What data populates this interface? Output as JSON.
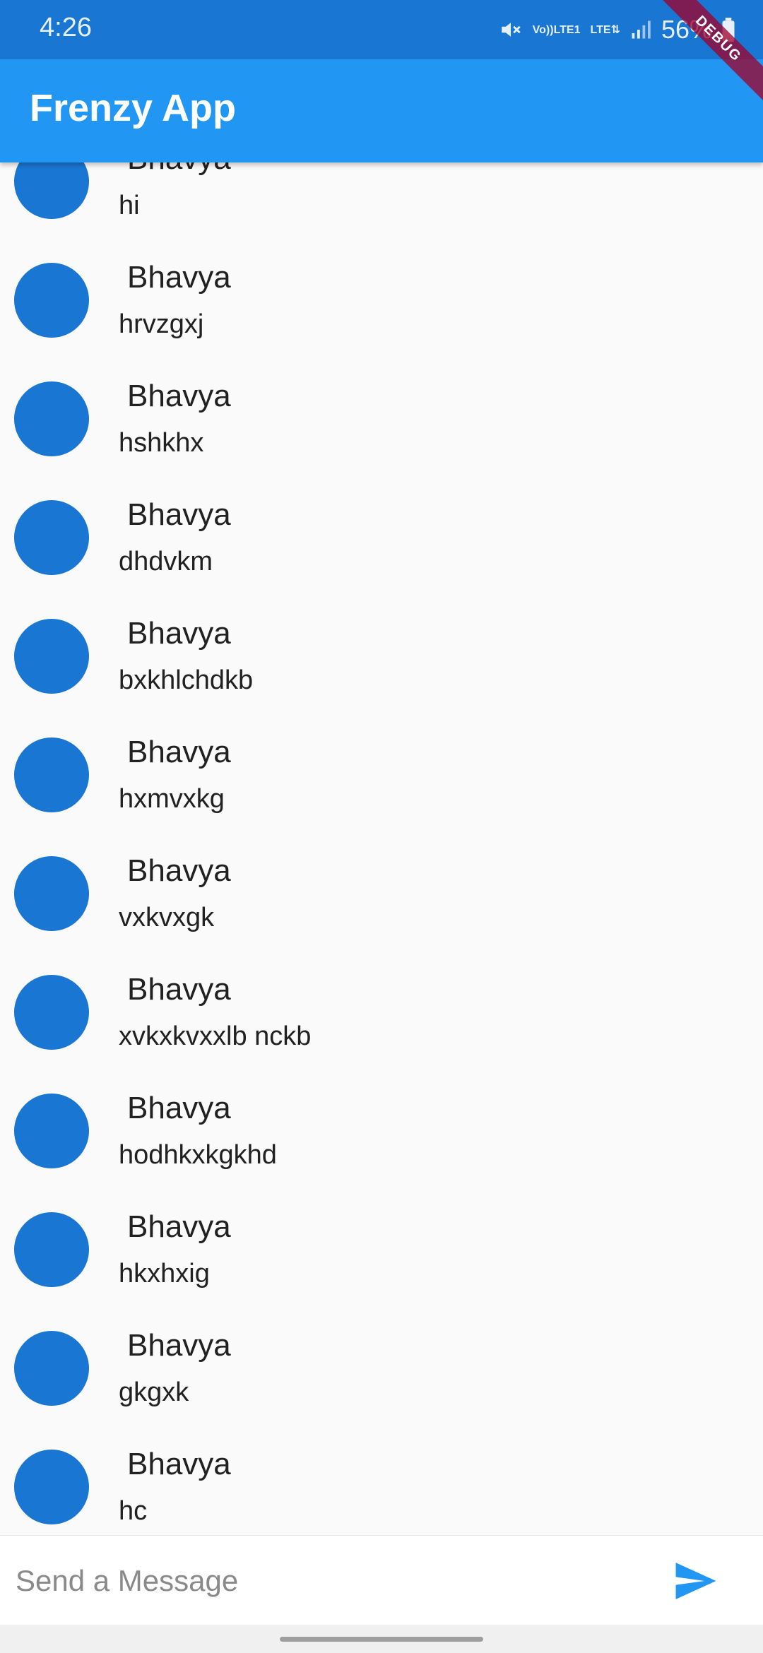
{
  "status_bar": {
    "time": "4:26",
    "volte_top": "Vo))",
    "volte_bottom": "LTE1",
    "network": "LTE",
    "battery": "56%"
  },
  "debug_banner": {
    "label": "DEBUG"
  },
  "app_bar": {
    "title": "Frenzy App"
  },
  "messages": [
    {
      "sender": "Bhavya",
      "text": "hi"
    },
    {
      "sender": "Bhavya",
      "text": "hrvzgxj"
    },
    {
      "sender": "Bhavya",
      "text": "hshkhx"
    },
    {
      "sender": "Bhavya",
      "text": "dhdvkm"
    },
    {
      "sender": "Bhavya",
      "text": "bxkhlchdkb"
    },
    {
      "sender": "Bhavya",
      "text": "hxmvxkg"
    },
    {
      "sender": "Bhavya",
      "text": "vxkvxgk"
    },
    {
      "sender": "Bhavya",
      "text": "xvkxkvxxlb nckb"
    },
    {
      "sender": "Bhavya",
      "text": "hodhkxkgkhd"
    },
    {
      "sender": "Bhavya",
      "text": "hkxhxig"
    },
    {
      "sender": "Bhavya",
      "text": "gkgxk"
    },
    {
      "sender": "Bhavya",
      "text": "hc"
    }
  ],
  "composer": {
    "placeholder": "Send a Message",
    "value": "",
    "send_icon": "send-icon"
  },
  "colors": {
    "status_bar": "#1976d2",
    "app_bar": "#2196f3",
    "avatar": "#1976d2",
    "send_icon": "#2196f3",
    "background": "#fafafa"
  }
}
